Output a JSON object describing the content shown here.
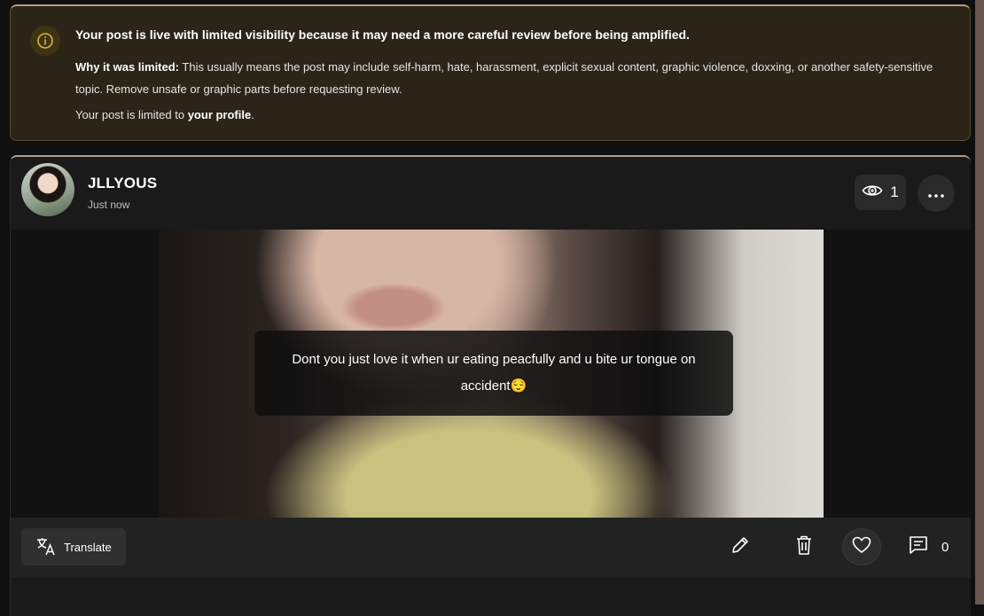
{
  "notice": {
    "title": "Your post is live with limited visibility because it may need a more careful review before being amplified.",
    "why_label": "Why it was limited:",
    "why_text": " This usually means the post may include self-harm, hate, harassment, explicit sexual content, graphic violence, doxxing, or another safety-sensitive topic. Remove unsafe or graphic parts before requesting review.",
    "limited_prefix": "Your post is limited to ",
    "limited_target": "your profile",
    "limited_suffix": ".",
    "icon": "info-icon",
    "accent_color": "#d9b445"
  },
  "post": {
    "username": "JLLYOUS",
    "timestamp": "Just now",
    "views": "1",
    "caption": "Dont you just love it when ur eating peacfully and u bite ur tongue on accident😌",
    "translate_label": "Translate",
    "comment_count": "0",
    "icons": {
      "views": "eye-icon",
      "more": "more-horizontal-icon",
      "translate": "translate-icon",
      "edit": "pencil-icon",
      "delete": "trash-icon",
      "like": "heart-icon",
      "comment": "comment-icon"
    }
  }
}
